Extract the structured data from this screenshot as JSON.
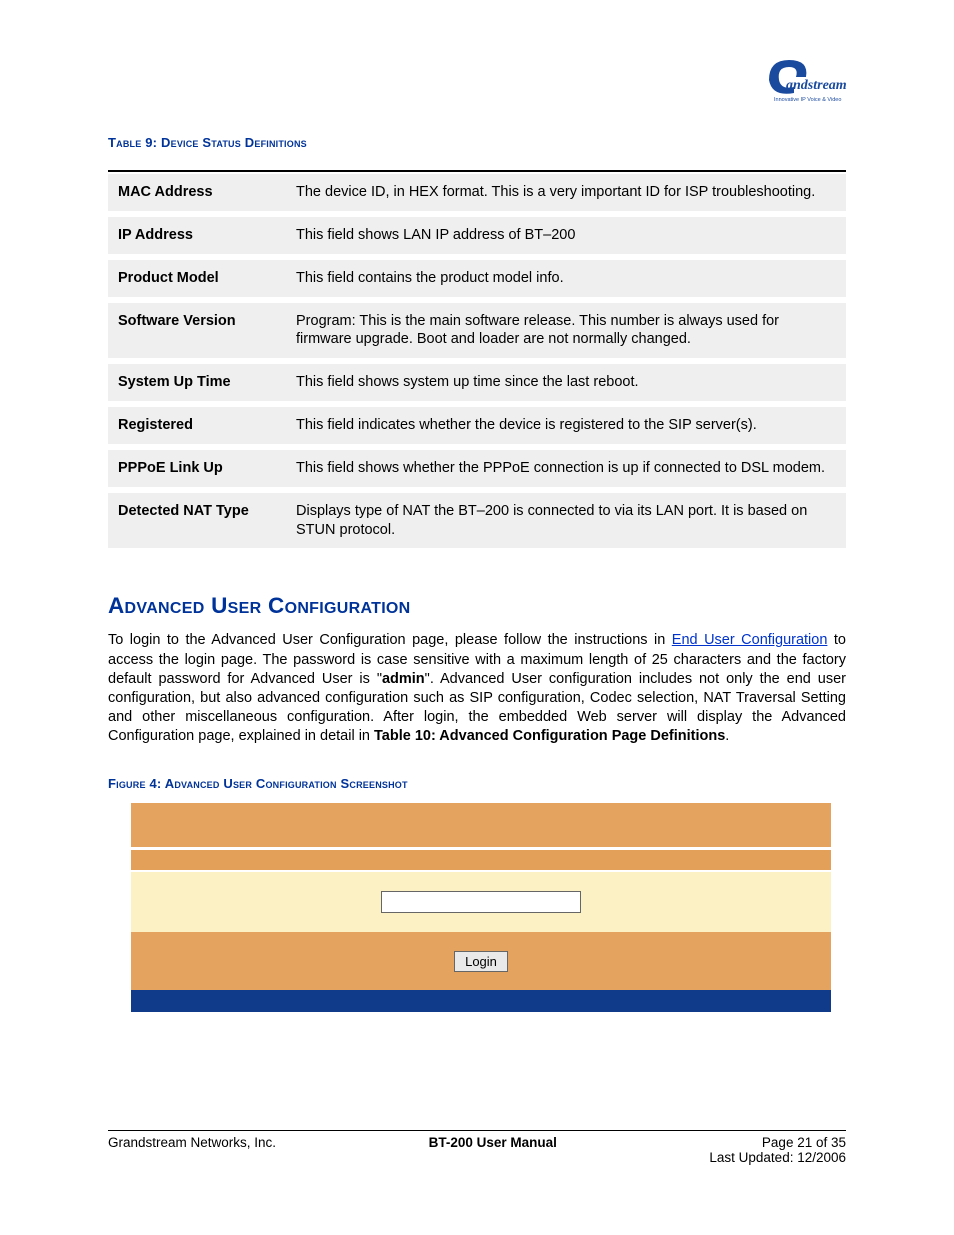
{
  "logo": {
    "brand": "Grandstream",
    "tagline": "Innovative IP Voice & Video"
  },
  "table9": {
    "caption": "Table 9:  Device Status Definitions",
    "rows": [
      {
        "label": "MAC Address",
        "desc": "The device ID, in HEX format.  This is a very important ID for ISP troubleshooting."
      },
      {
        "label": "IP Address",
        "desc": "This field shows LAN IP address of BT–200"
      },
      {
        "label": "Product Model",
        "desc": "This field contains the product model info."
      },
      {
        "label": "Software Version",
        "desc": "Program: This is the main software release.  This number is always used for firmware upgrade. Boot and loader are not normally changed."
      },
      {
        "label": "System Up Time",
        "desc": "This field shows system up time since the last reboot."
      },
      {
        "label": "Registered",
        "desc": "This field indicates whether the device is registered to the SIP server(s)."
      },
      {
        "label": "PPPoE Link Up",
        "desc": "This field shows whether the PPPoE connection is up if connected to DSL modem."
      },
      {
        "label": "Detected NAT Type",
        "desc": "Displays type of NAT the BT–200 is connected to via its LAN port.  It is based on STUN protocol."
      }
    ]
  },
  "section": {
    "heading": "Advanced User Configuration",
    "para_pre": "To login to the Advanced User Configuration page, please follow the instructions in ",
    "link_text": "End User Configuration",
    "para_mid": " to access the login page. The password is case sensitive with a maximum length of 25 characters and the factory default password for Advanced User is \"",
    "bold1": "admin",
    "para_mid2": "\".  Advanced User configuration includes not only the end user configuration, but also advanced configuration such as SIP configuration, Codec selection, NAT Traversal Setting and other miscellaneous configuration.   After login, the embedded Web server will display the Advanced Configuration page, explained in detail in ",
    "bold2": "Table 10: Advanced Configuration Page Definitions",
    "para_end": "."
  },
  "figure4": {
    "caption": "Figure 4:  Advanced User Configuration Screenshot",
    "login_button": "Login"
  },
  "footer": {
    "left": "Grandstream Networks, Inc.",
    "mid": "BT-200 User Manual",
    "right_page": "Page 21 of 35",
    "right_date": "Last Updated:  12/2006"
  }
}
